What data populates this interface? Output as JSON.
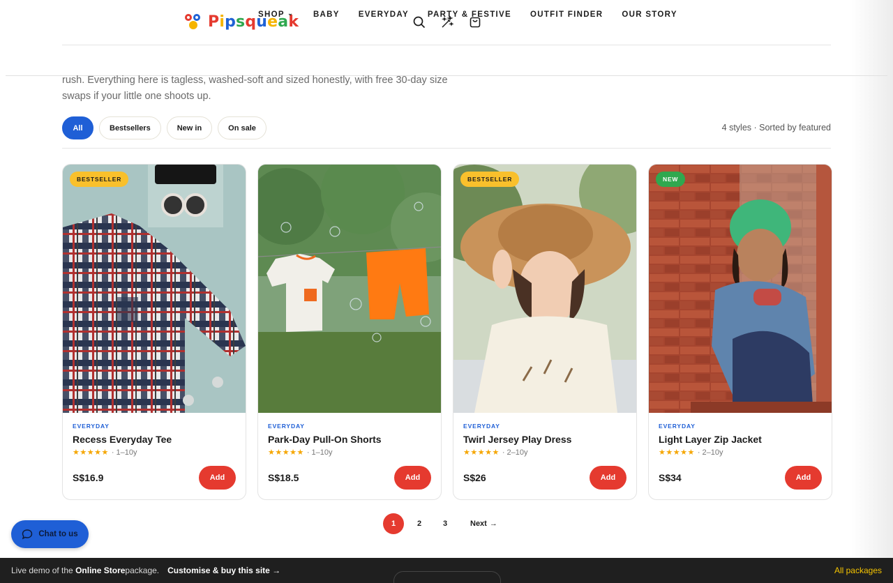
{
  "brand": {
    "name": "Pipsqueak",
    "colors": [
      "#e53a2f",
      "#f5b400",
      "#1f62d6",
      "#2fa84f"
    ]
  },
  "header": {
    "icons": [
      "search-icon",
      "magic-wand-icon",
      "shopping-bag-icon"
    ]
  },
  "nav": {
    "items": [
      {
        "label": "SHOP",
        "has_dropdown": true
      },
      {
        "label": "BABY"
      },
      {
        "label": "EVERYDAY"
      },
      {
        "label": "PARTY & FESTIVE"
      },
      {
        "label": "OUTFIT FINDER"
      },
      {
        "label": "OUR STORY"
      }
    ],
    "dropdown_glyph": "⌄"
  },
  "intro": {
    "text": "rush. Everything here is tagless, washed-soft and sized honestly, with free 30-day size swaps if your little one shoots up."
  },
  "filters": {
    "items": [
      {
        "label": "All",
        "active": true
      },
      {
        "label": "Bestsellers"
      },
      {
        "label": "New in"
      },
      {
        "label": "On sale"
      }
    ],
    "meta": "4 styles · Sorted by featured"
  },
  "products": [
    {
      "badge": "BESTSELLER",
      "badge_color": "#f9c02c",
      "category": "EVERYDAY",
      "name": "Recess Everyday Tee",
      "stars": "★★★★★",
      "rating": 5,
      "ages": "· 1–10y",
      "price": "S$16.9",
      "add_label": "Add"
    },
    {
      "badge": "",
      "category": "EVERYDAY",
      "name": "Park-Day Pull-On Shorts",
      "stars": "★★★★★",
      "rating": 5,
      "ages": "· 1–10y",
      "price": "S$18.5",
      "add_label": "Add"
    },
    {
      "badge": "BESTSELLER",
      "badge_color": "#f9c02c",
      "category": "EVERYDAY",
      "name": "Twirl Jersey Play Dress",
      "stars": "★★★★★",
      "rating": 5,
      "ages": "· 2–10y",
      "price": "S$26",
      "add_label": "Add"
    },
    {
      "badge": "NEW",
      "badge_color": "#2fa84f",
      "category": "EVERYDAY",
      "name": "Light Layer Zip Jacket",
      "stars": "★★★★★",
      "rating": 5,
      "ages": "· 2–10y",
      "price": "S$34",
      "add_label": "Add"
    }
  ],
  "pagination": {
    "pages": [
      "1",
      "2",
      "3"
    ],
    "current": "1",
    "next_label": "Next",
    "next_arrow": "→"
  },
  "chat": {
    "label": "Chat to us"
  },
  "demo_bar": {
    "prefix": "Live demo of the ",
    "package_name": "Online Store",
    "suffix": " package.",
    "customise_label": "Customise & buy this site →",
    "all_packages_label": "All packages"
  }
}
